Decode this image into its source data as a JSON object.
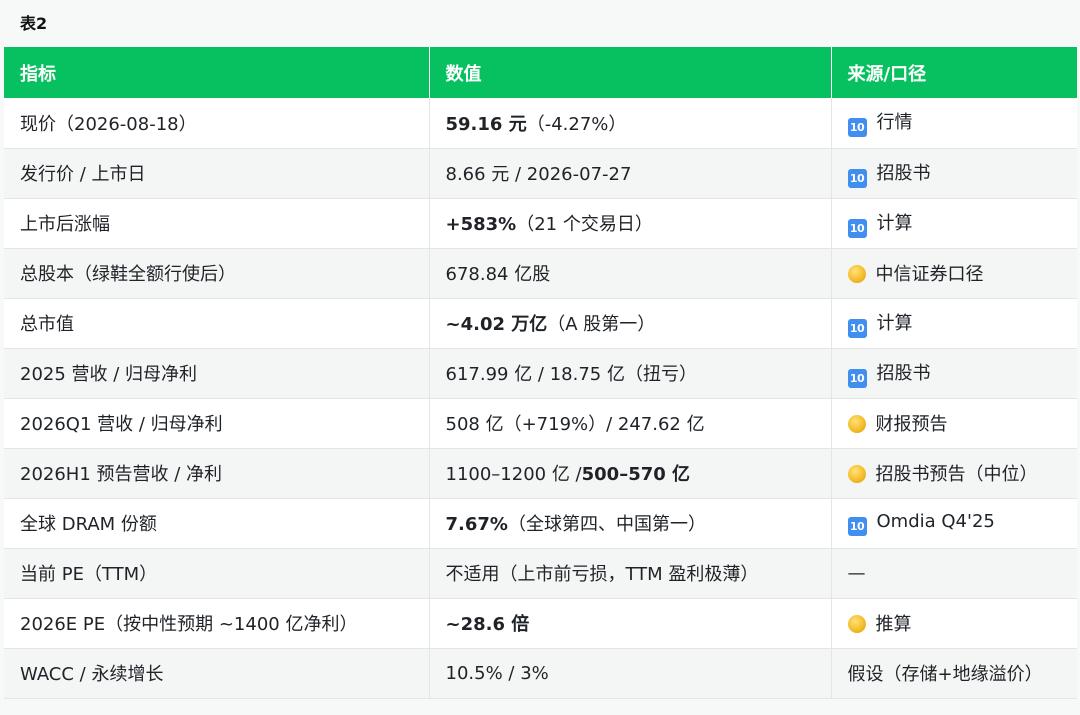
{
  "caption": "表2",
  "headers": [
    "指标",
    "数值",
    "来源/口径"
  ],
  "rows": [
    {
      "indicator": "现价（2026-08-18）",
      "value_bold": "59.16 元",
      "value_rest": "（-4.27%）",
      "icon": "keycap-ten-icon",
      "source": "行情"
    },
    {
      "indicator": "发行价 / 上市日",
      "value_plain": "8.66 元 / 2026-07-27",
      "icon": "keycap-ten-icon",
      "source": "招股书"
    },
    {
      "indicator": "上市后涨幅",
      "value_bold": "+583%",
      "value_rest": "（21 个交易日）",
      "icon": "keycap-ten-icon",
      "source": "计算"
    },
    {
      "indicator": "总股本（绿鞋全额行使后）",
      "value_plain": "678.84 亿股",
      "icon": "yellow-circle-icon",
      "source": "中信证券口径"
    },
    {
      "indicator": "总市值",
      "value_bold": "~4.02 万亿",
      "value_rest": "（A 股第一）",
      "icon": "keycap-ten-icon",
      "source": "计算"
    },
    {
      "indicator": "2025 营收 / 归母净利",
      "value_plain": "617.99 亿 / 18.75 亿（扭亏）",
      "icon": "keycap-ten-icon",
      "source": "招股书"
    },
    {
      "indicator": "2026Q1 营收 / 归母净利",
      "value_plain": "508 亿（+719%）/ 247.62 亿",
      "icon": "yellow-circle-icon",
      "source": "财报预告"
    },
    {
      "indicator": "2026H1 预告营收 / 净利",
      "value_plain": "1100–1200 亿 /",
      "value_bold_after": "500–570 亿",
      "icon": "yellow-circle-icon",
      "source": "招股书预告（中位）"
    },
    {
      "indicator": "全球 DRAM 份额",
      "value_bold": "7.67%",
      "value_rest": "（全球第四、中国第一）",
      "icon": "keycap-ten-icon",
      "source": "Omdia Q4'25"
    },
    {
      "indicator": "当前 PE（TTM）",
      "value_plain": "不适用（上市前亏损，TTM 盈利极薄）",
      "source": "—"
    },
    {
      "indicator": "2026E PE（按中性预期 ~1400 亿净利）",
      "value_bold": "~28.6 倍",
      "icon": "yellow-circle-icon",
      "source": "推算"
    },
    {
      "indicator": "WACC / 永续增长",
      "value_plain": "10.5% / 3%",
      "source": "假设（存储+地缘溢价）"
    }
  ]
}
